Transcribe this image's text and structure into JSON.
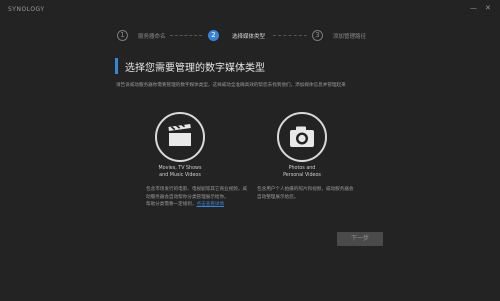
{
  "app": {
    "logo": "SYNOLOGY"
  },
  "window_controls": {
    "minimize": "—",
    "close": "✕"
  },
  "steps": [
    {
      "number": "1",
      "label": "服务器命名"
    },
    {
      "number": "2",
      "label": "选择媒体类型"
    },
    {
      "number": "3",
      "label": "添加管理路径"
    }
  ],
  "main": {
    "title": "选择您需要管理的数字媒体类型",
    "description": "请告诉威动服务器你需要管理的数字媒体类型，这样威动全准确高效的帮您去找到他们，添加媒体信息并管理起来"
  },
  "media_types": [
    {
      "icon": "film-clapper-icon",
      "label_line1": "Movies, TV Shows",
      "label_line2": "and Music Videos",
      "desc_line1": "包含市场发行的电影、电视剧等其它商业视频，威",
      "desc_line2": "动服务器会自动帮你分类管理展示给你。",
      "desc_line3": "帮助分类需要一定规则，",
      "desc_link": "点击查看详情"
    },
    {
      "icon": "camera-icon",
      "label_line1": "Photos and",
      "label_line2": "Personal Videos",
      "desc_line1": "包含用户个人拍摄的照片和视频，威动服务器会",
      "desc_line2": "自动整理展示给您。"
    }
  ],
  "footer": {
    "next_label": "下一步"
  }
}
